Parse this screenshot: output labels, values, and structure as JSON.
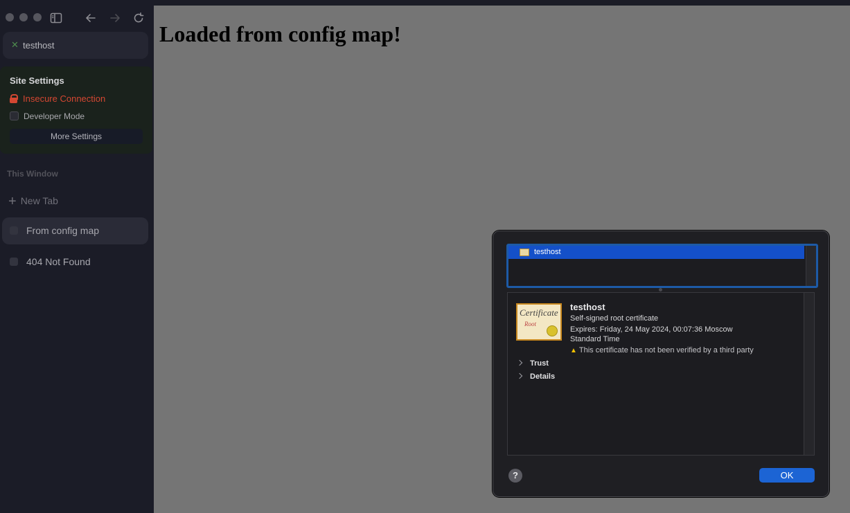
{
  "toolbar": {
    "traffic_lights": [
      "close",
      "minimize",
      "zoom"
    ],
    "icons": [
      "sidebar-toggle-icon",
      "back-arrow-icon",
      "forward-arrow-icon",
      "reload-icon"
    ]
  },
  "url_bar": {
    "host": "testhost",
    "icon": "close-x-icon"
  },
  "site_settings": {
    "title": "Site Settings",
    "insecure_label": "Insecure Connection",
    "developer_mode_label": "Developer Mode",
    "developer_mode_checked": false,
    "more_settings_label": "More Settings",
    "insecure_color": "#d44732"
  },
  "sidebar": {
    "section_label": "This Window",
    "new_tab_label": "New Tab",
    "tabs": [
      {
        "label": "From config map",
        "active": true
      },
      {
        "label": "404 Not Found",
        "active": false
      }
    ]
  },
  "page": {
    "heading": "Loaded from config map!"
  },
  "cert_dialog": {
    "list_items": [
      "testhost"
    ],
    "cert_image": {
      "title": "Certificate",
      "subtitle": "Root"
    },
    "name": "testhost",
    "type": "Self-signed root certificate",
    "expires": "Expires: Friday, 24 May 2024, 00:07:36 Moscow Standard Time",
    "warning": "This certificate has not been verified by a third party",
    "sections": [
      "Trust",
      "Details"
    ],
    "help_label": "?",
    "ok_label": "OK",
    "accent": "#1c64d4"
  }
}
